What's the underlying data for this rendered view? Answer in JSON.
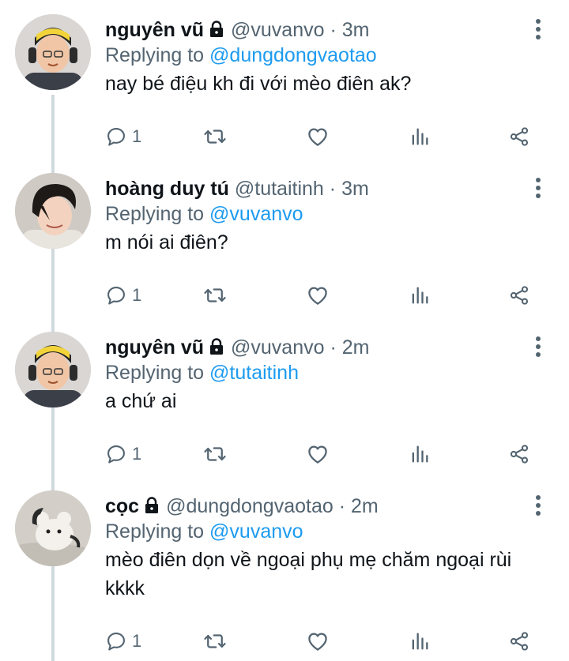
{
  "icons": {
    "reply": "reply-icon",
    "retweet": "retweet-icon",
    "like": "heart-icon",
    "stats": "stats-icon",
    "share": "share-icon",
    "more": "more-vertical-icon",
    "lock": "lock-icon"
  },
  "colors": {
    "text": "#0f1419",
    "secondary": "#536471",
    "mention": "#1d9bf0",
    "thread_line": "#cfd9de"
  },
  "tweets": [
    {
      "name": "nguyên vũ",
      "handle": "@vuvanvo",
      "dot": "·",
      "time": "3m",
      "replying_prefix": "Replying to ",
      "replying_to": "@dungdongvaotao",
      "text": "nay bé điệu kh đi với mèo điên ak?",
      "reply_count": "1"
    },
    {
      "name": "hoàng duy tú",
      "handle": "@tutaitinh",
      "dot": "·",
      "time": "3m",
      "replying_prefix": "Replying to ",
      "replying_to": "@vuvanvo",
      "text": "m nói ai điên?",
      "reply_count": "1"
    },
    {
      "name": "nguyên vũ",
      "handle": "@vuvanvo",
      "dot": "·",
      "time": "2m",
      "replying_prefix": "Replying to ",
      "replying_to": "@tutaitinh",
      "text": "a chứ ai",
      "reply_count": "1"
    },
    {
      "name": "cọc",
      "handle": "@dungdongvaotao",
      "dot": "·",
      "time": "2m",
      "replying_prefix": "Replying to ",
      "replying_to": "@vuvanvo",
      "text": "mèo điên dọn về ngoại phụ mẹ chăm ngoại rùi kkkk",
      "reply_count": "1"
    }
  ]
}
